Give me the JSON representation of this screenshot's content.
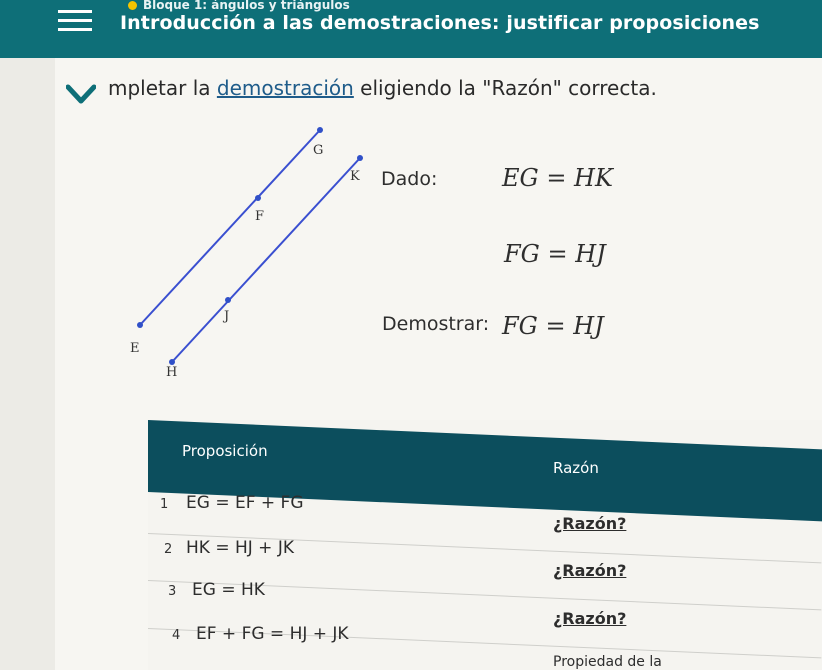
{
  "header": {
    "breadcrumb": "Bloque 1: ángulos y triángulos",
    "title": "Introducción a las demostraciones: justificar proposiciones"
  },
  "instruction": {
    "prefix": "mpletar la ",
    "link": "demostración",
    "suffix": " eligiendo la \"Razón\" correcta."
  },
  "diagram": {
    "points": [
      "G",
      "K",
      "F",
      "J",
      "E",
      "H"
    ]
  },
  "given": {
    "label": "Dado:",
    "statements": [
      "EG = HK",
      "FG = HJ"
    ]
  },
  "prove": {
    "label": "Demostrar:",
    "statement": "FG = HJ"
  },
  "table": {
    "col_proposition": "Proposición",
    "col_reason": "Razón",
    "rows": [
      {
        "num": "1",
        "proposition": "EG = EF + FG",
        "reason": "¿Razón?"
      },
      {
        "num": "2",
        "proposition": "HK = HJ + JK",
        "reason": "¿Razón?"
      },
      {
        "num": "3",
        "proposition": "EG = HK",
        "reason": "¿Razón?"
      },
      {
        "num": "4",
        "proposition": "EF + FG = HJ + JK",
        "reason": "Propiedad de la"
      }
    ]
  },
  "colors": {
    "header": "#0e6f78",
    "table_header": "#0c4e5d",
    "point": "#3050c8",
    "segment": "#3a4fd0"
  }
}
